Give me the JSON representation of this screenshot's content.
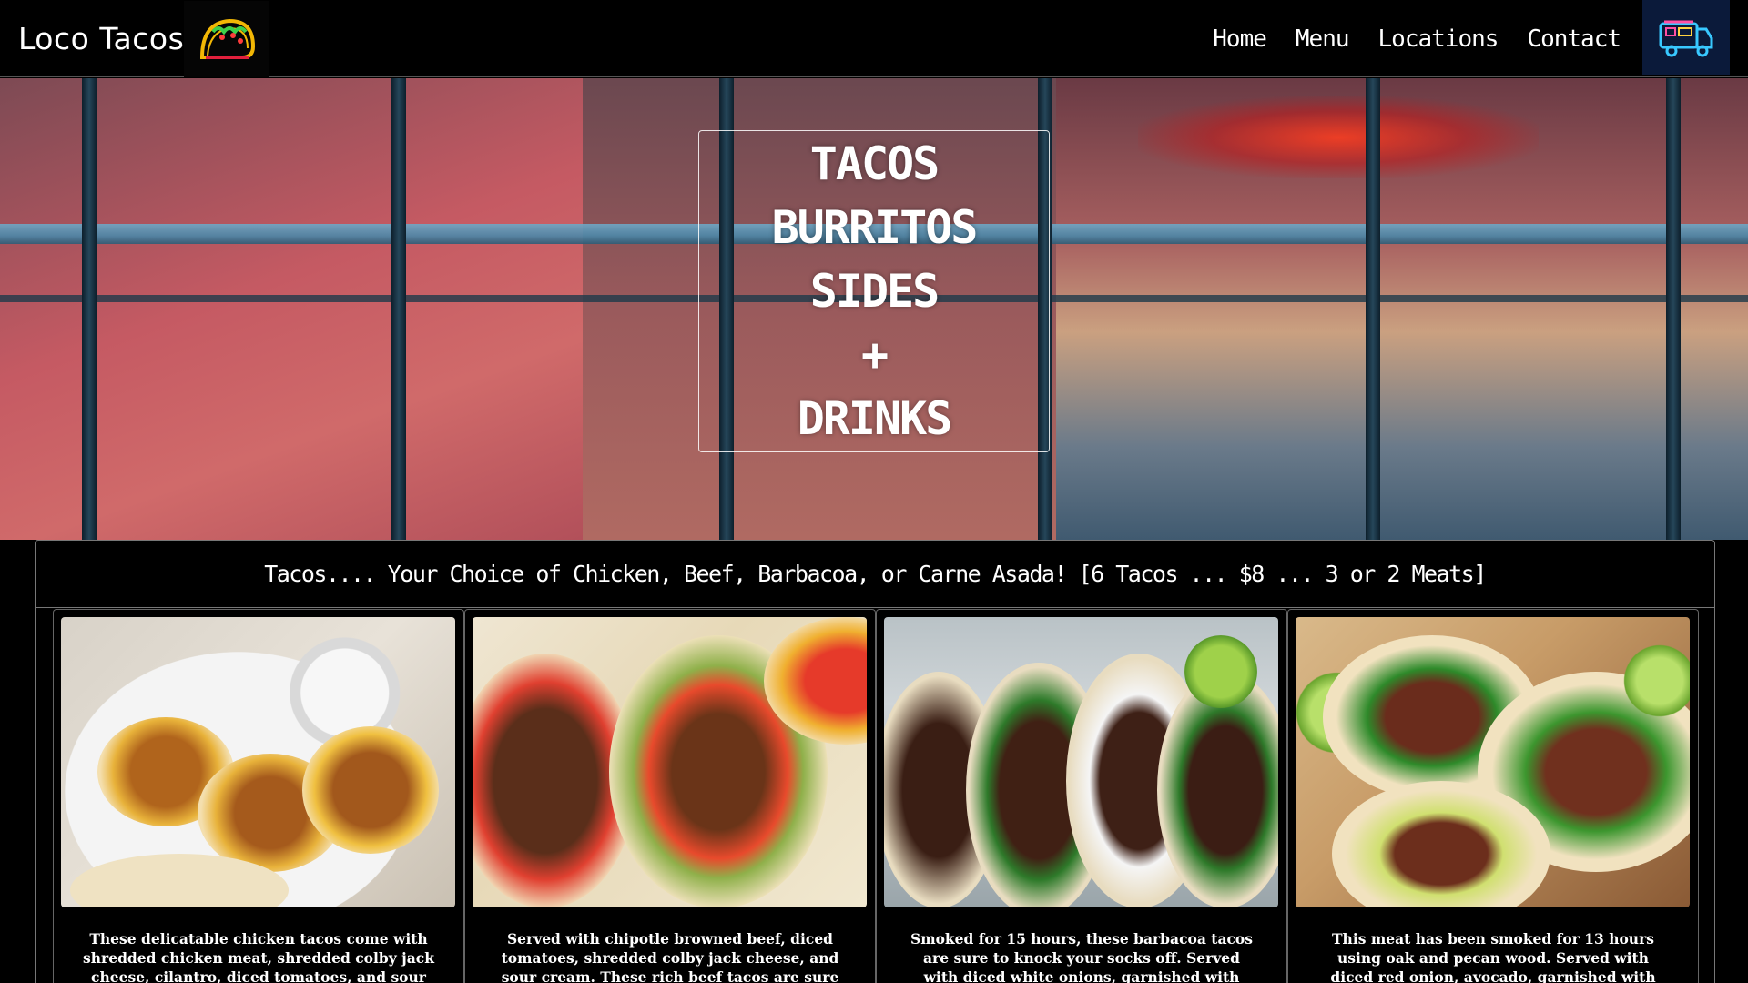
{
  "nav": {
    "brand": "Loco Tacos",
    "links": [
      "Home",
      "Menu",
      "Locations",
      "Contact"
    ]
  },
  "hero": {
    "lines": [
      "TACOS",
      "BURRITOS",
      "SIDES",
      "+",
      "DRINKS"
    ]
  },
  "tacos": {
    "title": "Tacos.... Your Choice of Chicken, Beef, Barbacoa, or Carne Asada! [6 Tacos ... $8 ... 3 or 2 Meats]",
    "cards": [
      {
        "text": "These delicatable chicken tacos come with shredded chicken meat, shredded colby jack cheese, cilantro, diced tomatoes, and sour"
      },
      {
        "text": "Served with chipotle browned beef, diced tomatoes, shredded colby jack cheese, and sour cream. These rich beef tacos are sure to"
      },
      {
        "text": "Smoked for 15 hours, these barbacoa tacos are sure to knock your socks off. Served with diced white onions, garnished with cilantro,"
      },
      {
        "text": "This meat has been smoked for 13 hours using oak and pecan wood. Served with diced red onion, avocado, garnished with cilantro, and"
      }
    ]
  },
  "icons": {
    "logo": "taco-icon",
    "truck": "food-truck-icon"
  },
  "colors": {
    "background": "#000000",
    "text": "#ffffff",
    "border": "#777777"
  }
}
